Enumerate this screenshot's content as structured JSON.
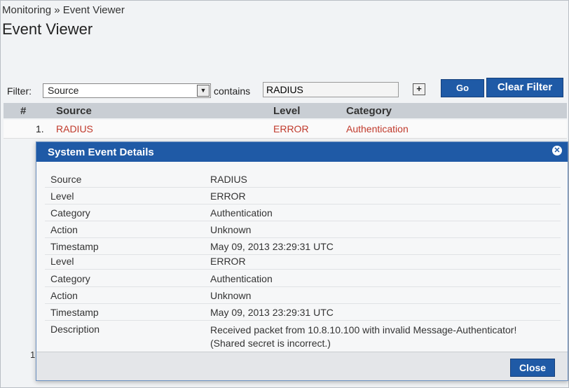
{
  "breadcrumb": "Monitoring » Event Viewer",
  "page_title": "Event Viewer",
  "filter": {
    "label": "Filter:",
    "field_value": "Source",
    "operator_label": "contains",
    "input_value": "RADIUS",
    "add_label": "+",
    "go_label": "Go",
    "clear_label": "Clear Filter"
  },
  "table": {
    "headers": [
      "#",
      "Source",
      "Level",
      "Category"
    ],
    "rows": [
      {
        "num": "1.",
        "source": "RADIUS",
        "level": "ERROR",
        "category": "Authentication"
      }
    ],
    "second_row_num": "1"
  },
  "modal": {
    "title": "System Event Details",
    "details_top": [
      {
        "key": "Source",
        "value": "RADIUS"
      },
      {
        "key": "Level",
        "value": "ERROR"
      },
      {
        "key": "Category",
        "value": "Authentication"
      },
      {
        "key": "Action",
        "value": "Unknown"
      },
      {
        "key": "Timestamp",
        "value": "May 09, 2013 23:29:31 UTC"
      }
    ],
    "details_bottom": [
      {
        "key": "Level",
        "value": "ERROR"
      },
      {
        "key": "Category",
        "value": "Authentication"
      },
      {
        "key": "Action",
        "value": "Unknown"
      },
      {
        "key": "Timestamp",
        "value": "May 09, 2013 23:29:31 UTC"
      },
      {
        "key": "Description",
        "value": "Received packet from 10.8.10.100 with invalid Message-Authenticator! (Shared secret is incorrect.)"
      }
    ],
    "close_label": "Close"
  },
  "colors": {
    "accent": "#1f5aa6",
    "error_text": "#c0392b"
  }
}
